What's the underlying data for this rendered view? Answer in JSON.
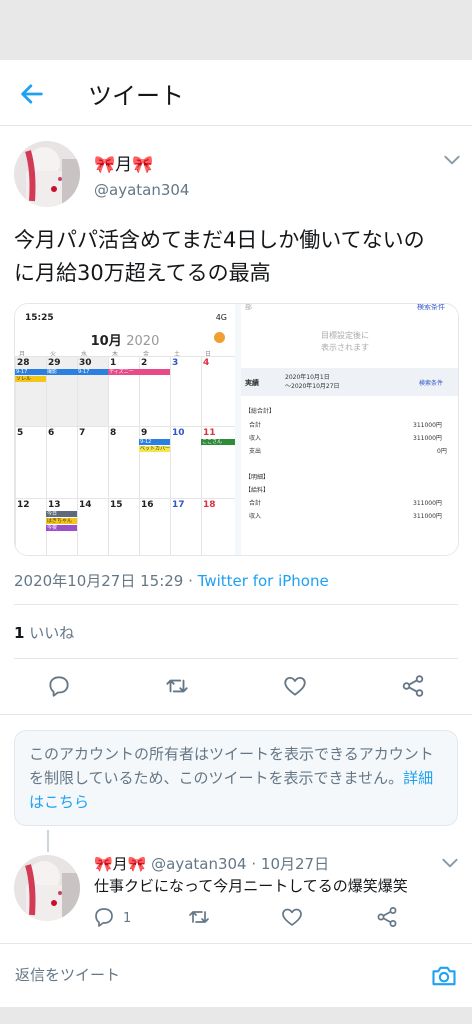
{
  "header": {
    "title": "ツイート"
  },
  "tweet": {
    "display_name": "🎀月🎀",
    "handle": "@ayatan304",
    "text_line1": "今月パパ活含めてまだ4日しか働いてないの",
    "text_line2": "に月給30万超えてるの最高",
    "timestamp": "2020年10月27日 15:29 · ",
    "source": "Twitter for iPhone",
    "likes_count": "1",
    "likes_label": " いいね"
  },
  "media": {
    "calendar": {
      "status_time": "15:25",
      "status_right": "4G",
      "month": "10月",
      "year": "2020",
      "weekdays": [
        "月",
        "火",
        "水",
        "木",
        "金",
        "土",
        "日"
      ],
      "weeks": [
        [
          "28",
          "29",
          "30",
          "1",
          "2",
          "3",
          "4"
        ],
        [
          "5",
          "6",
          "7",
          "8",
          "9",
          "10",
          "11"
        ],
        [
          "12",
          "13",
          "14",
          "15",
          "16",
          "17",
          "18"
        ]
      ],
      "events": {
        "e1": "9-17",
        "e2": "ソレル",
        "e3": "撮影",
        "e4": "9-17",
        "e5": "ディズニー",
        "e6": "9-12",
        "e7": "ベットカバー",
        "e8": "ここさん",
        "e9": "今日",
        "e10": "はぎちゃん",
        "e11": "今夜"
      }
    },
    "report": {
      "top_left": "部",
      "top_right": "検索条件",
      "placeholder_line1": "目標設定後に",
      "placeholder_line2": "表示されます",
      "actual_label": "実績",
      "period_line1": "2020年10月1日",
      "period_line2": "～2020年10月27日",
      "search_conditions": "検索条件",
      "total_section": "【総合計】",
      "rows": [
        {
          "label": "合計",
          "value": "311000円"
        },
        {
          "label": "収入",
          "value": "311000円"
        },
        {
          "label": "支出",
          "value": "0円"
        }
      ],
      "detail_section": "【明細】",
      "salary_section": "【給料】",
      "salary_rows": [
        {
          "label": "合計",
          "value": "311000円"
        },
        {
          "label": "収入",
          "value": "311000円"
        }
      ]
    }
  },
  "notice": {
    "text": "このアカウントの所有者はツイートを表示できるアカウントを制限しているため、このツイートを表示できません。",
    "link": "詳細はこちら"
  },
  "reply": {
    "display_name": "🎀月🎀",
    "meta": " @ayatan304 · 10月27日",
    "text": "仕事クビになって今月ニートしてるの爆笑爆笑",
    "reply_count": "1"
  },
  "compose": {
    "placeholder": "返信をツイート"
  },
  "colors": {
    "accent": "#1da1f2",
    "text_secondary": "#657786",
    "border": "#e1e8ed"
  },
  "icons": [
    "back-arrow-icon",
    "chevron-down-icon",
    "reply-icon",
    "retweet-icon",
    "like-icon",
    "share-icon",
    "camera-icon"
  ]
}
